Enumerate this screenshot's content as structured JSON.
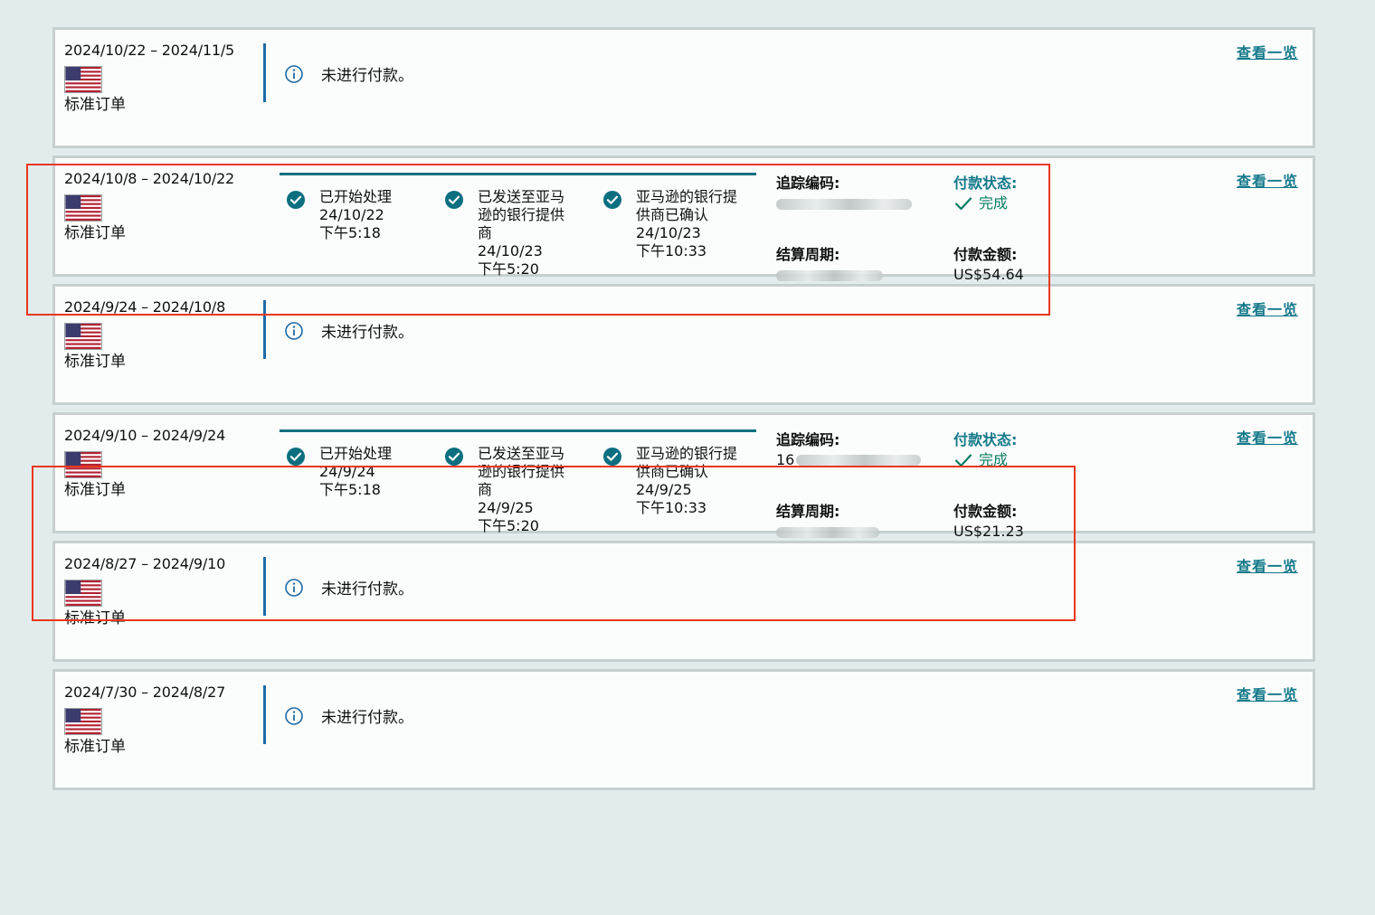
{
  "icons": {
    "flag": "us-flag-icon",
    "info": "info-circle-icon",
    "check": "check-circle-icon",
    "tick": "checkmark-icon"
  },
  "colors": {
    "link": "#14798a",
    "separator": "#1e6aa6",
    "progress": "#0b6f80",
    "success": "#067d62",
    "highlight": "#e8381c"
  },
  "settlements": [
    {
      "period": "2024/10/22 – 2024/11/5",
      "order_type": "标准订单",
      "view_label": "查看一览",
      "unpaid_text": "未进行付款。"
    },
    {
      "period": "2024/10/8 – 2024/10/22",
      "order_type": "标准订单",
      "view_label": "查看一览",
      "steps": [
        {
          "label": "已开始处理",
          "date": "24/10/22",
          "time": "下午5:18"
        },
        {
          "label": "已发送至亚马逊的银行提供商",
          "date": "24/10/23",
          "time": "下午5:20"
        },
        {
          "label": "亚马逊的银行提供商已确认",
          "date": "24/10/23",
          "time": "下午10:33"
        }
      ],
      "tracking_label": "追踪编码:",
      "tracking_value": "",
      "cycle_label": "结算周期:",
      "cycle_value": "",
      "status_label": "付款状态:",
      "status_value": "完成",
      "amount_label": "付款金额:",
      "amount_value": "US$54.64"
    },
    {
      "period": "2024/9/24 – 2024/10/8",
      "order_type": "标准订单",
      "view_label": "查看一览",
      "unpaid_text": "未进行付款。"
    },
    {
      "period": "2024/9/10 – 2024/9/24",
      "order_type": "标准订单",
      "view_label": "查看一览",
      "steps": [
        {
          "label": "已开始处理",
          "date": "24/9/24",
          "time": "下午5:18"
        },
        {
          "label": "已发送至亚马逊的银行提供商",
          "date": "24/9/25",
          "time": "下午5:20"
        },
        {
          "label": "亚马逊的银行提供商已确认",
          "date": "24/9/25",
          "time": "下午10:33"
        }
      ],
      "tracking_label": "追踪编码:",
      "tracking_value": "16",
      "cycle_label": "结算周期:",
      "cycle_value": "",
      "status_label": "付款状态:",
      "status_value": "完成",
      "amount_label": "付款金额:",
      "amount_value": "US$21.23"
    },
    {
      "period": "2024/8/27 – 2024/9/10",
      "order_type": "标准订单",
      "view_label": "查看一览",
      "unpaid_text": "未进行付款。"
    },
    {
      "period": "2024/7/30 – 2024/8/27",
      "order_type": "标准订单",
      "view_label": "查看一览",
      "unpaid_text": "未进行付款。"
    }
  ]
}
